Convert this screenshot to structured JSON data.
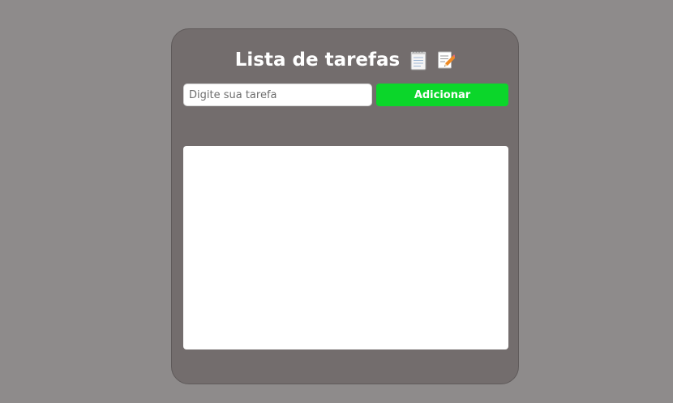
{
  "app": {
    "title": "Lista de tarefas",
    "icons": [
      "notepad-icon",
      "memo-pencil-icon"
    ]
  },
  "form": {
    "input_placeholder": "Digite sua tarefa",
    "input_value": "",
    "add_label": "Adicionar"
  },
  "tasks": [],
  "colors": {
    "page_background": "#8e8b8b",
    "card_background": "#736d6d",
    "accent": "#0bd62a",
    "list_background": "#ffffff"
  }
}
